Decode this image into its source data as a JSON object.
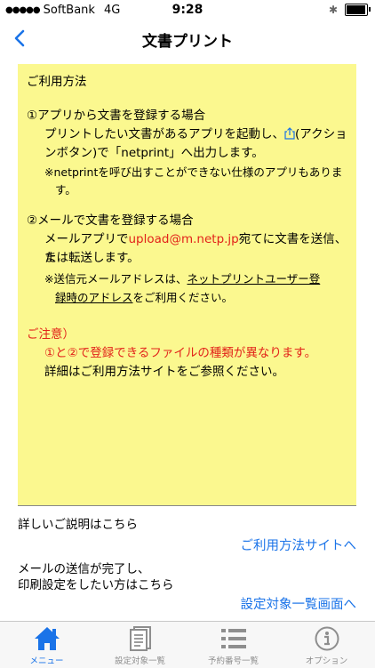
{
  "status_bar": {
    "carrier": "SoftBank",
    "network": "4G",
    "time": "9:28",
    "battery_percent": 95
  },
  "nav": {
    "title": "文書プリント",
    "back_icon": "chevron-left-icon"
  },
  "memo": {
    "heading": "ご利用方法",
    "section1_title": "①アプリから文書を登録する場合",
    "section1_line1a": "プリントしたい文書があるアプリを起動し、",
    "section1_line1b": "(アクショ",
    "section1_line2": "ンボタン)で「netprint」へ出力します。",
    "section1_note1": "※netprintを呼び出すことができない仕様のアプリもありま",
    "section1_note2": "す。",
    "section2_title": "②メールで文書を登録する場合",
    "section2_line1a": "メールアプリで",
    "section2_email": "upload@m.netp.jp",
    "section2_line1b": "宛てに文書を送信、ま",
    "section2_line2": "たは転送します。",
    "section2_note1a": "※送信元メールアドレスは、",
    "section2_note1b": "ネットプリントユーザー登",
    "section2_note2a": "録時のアドレス",
    "section2_note2b": "をご利用ください。",
    "caution_title": "ご注意）",
    "caution_line1": "①と②で登録できるファイルの種類が異なります。",
    "caution_line2": "詳細はご利用方法サイトをご参照ください。"
  },
  "bottom": {
    "detail_text": "詳しいご説明はこちら",
    "usage_site_link": "ご利用方法サイトへ",
    "mail_done_line1": "メールの送信が完了し、",
    "mail_done_line2": "印刷設定をしたい方はこちら",
    "settings_list_link": "設定対象一覧画面へ"
  },
  "tabs": [
    {
      "label": "メニュー",
      "icon": "home-icon",
      "active": true
    },
    {
      "label": "設定対象一覧",
      "icon": "document-icon",
      "active": false
    },
    {
      "label": "予約番号一覧",
      "icon": "list-icon",
      "active": false
    },
    {
      "label": "オプション",
      "icon": "info-icon",
      "active": false
    }
  ],
  "colors": {
    "accent": "#1a73e8",
    "memo_background": "#fbf88f",
    "warning_red": "#e2231a"
  }
}
